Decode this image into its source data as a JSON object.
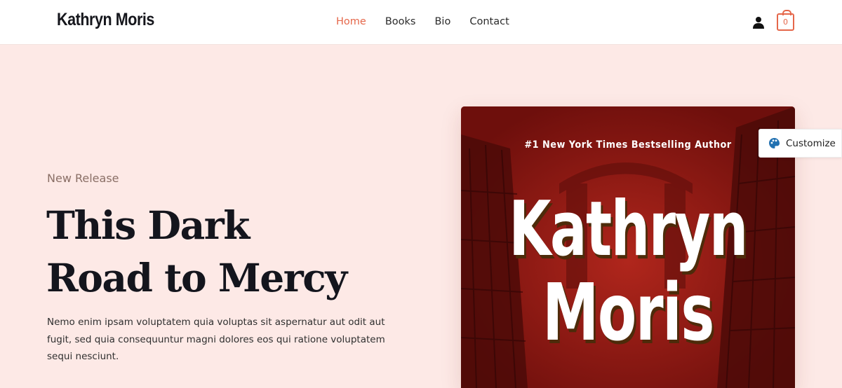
{
  "header": {
    "logo": "Kathryn Moris",
    "nav": [
      {
        "label": "Home",
        "active": true
      },
      {
        "label": "Books",
        "active": false
      },
      {
        "label": "Bio",
        "active": false
      },
      {
        "label": "Contact",
        "active": false
      }
    ],
    "account_icon": "user-icon",
    "cart_icon": "shopping-bag-icon",
    "cart_count": "0"
  },
  "hero": {
    "eyebrow": "New Release",
    "title_line1": "This Dark",
    "title_line2": "Road to Mercy",
    "description": "Nemo enim ipsam voluptatem quia voluptas sit aspernatur aut odit aut fugit, sed quia consequuntur magni dolores eos qui ratione voluptatem sequi nesciunt."
  },
  "cover": {
    "tagline": "#1 New York Times Bestselling Author",
    "first_name": "Kathryn",
    "last_name": "Moris"
  },
  "customize": {
    "icon": "palette-icon",
    "label": "Customize"
  },
  "colors": {
    "accent": "#e5674a",
    "hero_background": "#fde9e6",
    "cover_red": "#7c120f",
    "text_dark": "#14151d"
  }
}
